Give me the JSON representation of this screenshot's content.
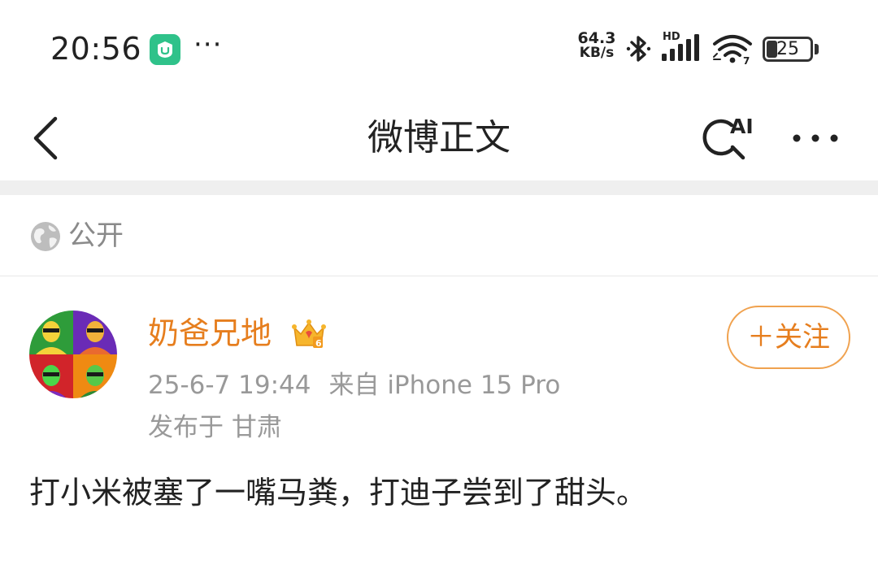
{
  "status_bar": {
    "time": "20:56",
    "notification_app_icon": "mi-home-app-icon",
    "notification_more": "···",
    "net_speed_value": "64.3",
    "net_speed_unit": "KB/s",
    "network_badge": "HD",
    "battery_level": "25",
    "battery_percent": 25
  },
  "header": {
    "title": "微博正文",
    "back_icon": "chevron-left-icon",
    "ai_search_icon": "ai-search-icon",
    "ai_label": "AI",
    "more_icon": "more-dots-icon"
  },
  "visibility": {
    "icon": "globe-icon",
    "label": "公开"
  },
  "post": {
    "author_name": "奶爸兄地",
    "badge_icon": "vip-crown-badge-icon",
    "timestamp": "25-6-7 19:44",
    "source": "来自 iPhone 15 Pro",
    "location": "发布于 甘肃",
    "follow_label": "＋关注",
    "text": "打小米被塞了一嘴马粪，打迪子尝到了甜头。"
  },
  "colors": {
    "accent_orange": "#e67e1e",
    "follow_border": "#f0a24f",
    "secondary_text": "#999999",
    "divider": "#efefef"
  }
}
